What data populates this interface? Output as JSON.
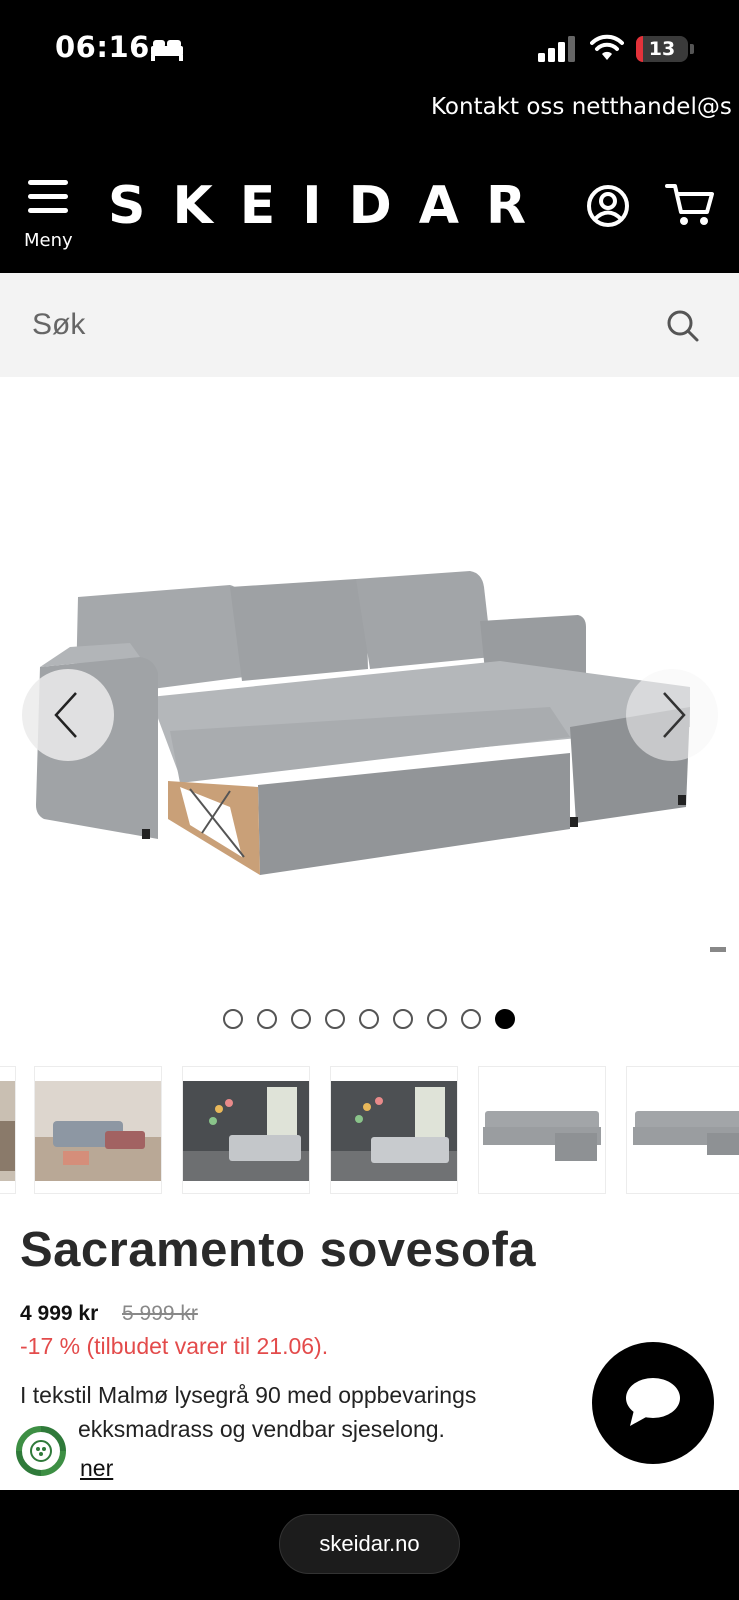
{
  "status_bar": {
    "time": "06:16",
    "battery_level": "13",
    "battery_fraction": 0.13,
    "icons": [
      "bed-icon",
      "signal-icon",
      "wifi-icon",
      "battery-icon"
    ]
  },
  "contact_bar": {
    "text": "Kontakt oss netthandel@s"
  },
  "header": {
    "menu_label": "Meny",
    "logo": "SKEIDAR",
    "icons": [
      "menu-icon",
      "account-icon",
      "cart-icon"
    ]
  },
  "search": {
    "placeholder": "Søk"
  },
  "gallery": {
    "image_count": 9,
    "active_index": 8,
    "icons": [
      "chevron-left-icon",
      "chevron-right-icon"
    ]
  },
  "thumbnails": [
    {
      "name": "thumb-partial"
    },
    {
      "name": "thumb-living-room-light"
    },
    {
      "name": "thumb-living-room-dark-1"
    },
    {
      "name": "thumb-living-room-dark-2"
    },
    {
      "name": "thumb-sofa-bed-open"
    },
    {
      "name": "thumb-sofa-corner"
    }
  ],
  "product": {
    "title": "Sacramento sovesofa",
    "price": "4 999 kr",
    "old_price": "5 999 kr",
    "offer": "-17 % (tilbudet varer til 21.06).",
    "description_line1": "I tekstil Malmø lysegrå 90 med oppbevarings",
    "description_line2": "ekksmadrass og vendbar sjeselong.",
    "more_link": "ner"
  },
  "browser": {
    "url": "skeidar.no"
  },
  "colors": {
    "header_bg": "#000000",
    "offer_red": "#e34b4b",
    "search_bg": "#f3f3f3"
  }
}
